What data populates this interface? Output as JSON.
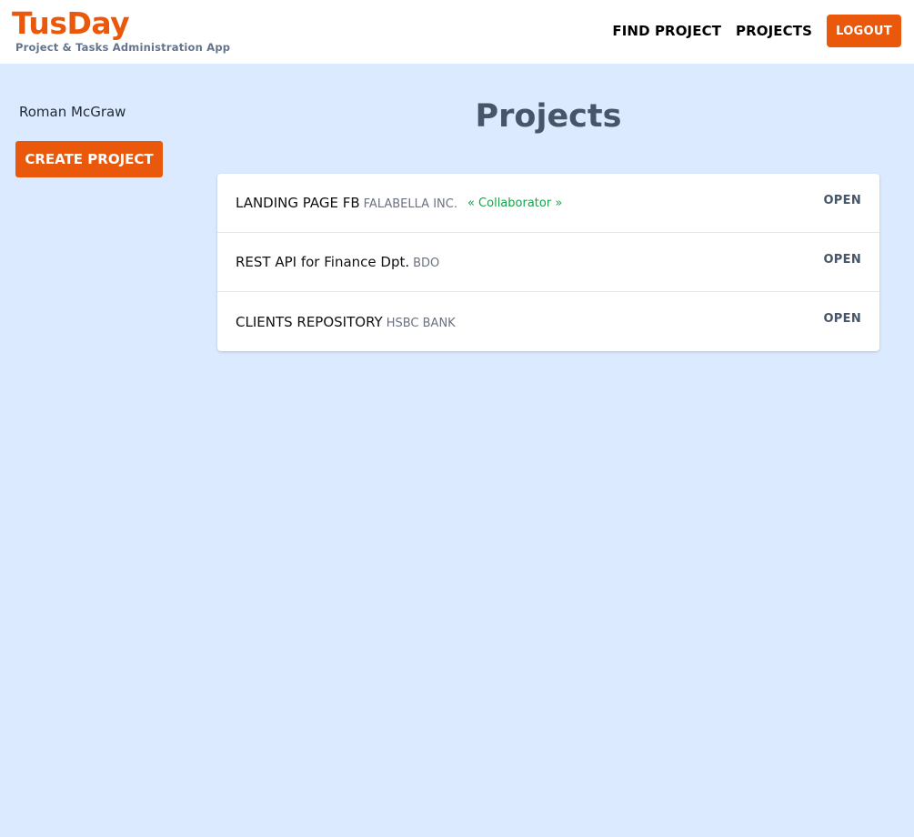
{
  "header": {
    "brand_name": "TusDay",
    "brand_subtitle": "Project & Tasks Administration App",
    "nav": {
      "find_project": "FIND PROJECT",
      "projects": "PROJECTS",
      "logout": "LOGOUT"
    }
  },
  "sidebar": {
    "user_name": "Roman McGraw",
    "create_project": "CREATE PROJECT"
  },
  "main": {
    "title": "Projects",
    "projects": [
      {
        "name": "LANDING PAGE FB",
        "client": "FALABELLA INC.",
        "role": "« Collaborator »",
        "action": "OPEN"
      },
      {
        "name": "REST API for Finance Dpt.",
        "client": "BDO",
        "role": "",
        "action": "OPEN"
      },
      {
        "name": "CLIENTS REPOSITORY",
        "client": "HSBC BANK",
        "role": "",
        "action": "OPEN"
      }
    ]
  },
  "colors": {
    "accent": "#ea580c",
    "background": "#dbeafe",
    "collaborator": "#16a34a",
    "muted": "#6b7280",
    "title": "#475569"
  }
}
